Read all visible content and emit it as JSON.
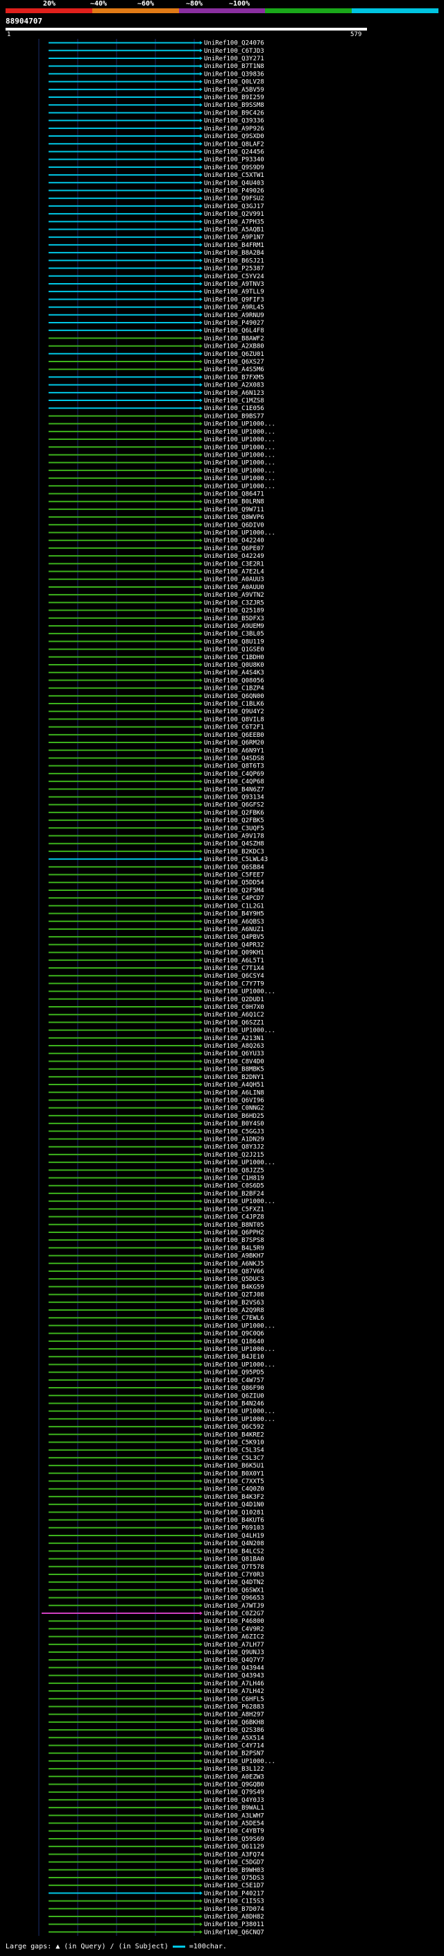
{
  "header": {
    "query_id": "88904707",
    "scale_start": "1",
    "scale_end": "579",
    "identity_legend": [
      {
        "label": "20%",
        "color": "#e0201c"
      },
      {
        "label": "~40%",
        "color": "#e07a16"
      },
      {
        "label": "~60%",
        "color": "#8a2fa0"
      },
      {
        "label": "~80%",
        "color": "#1aa81a"
      },
      {
        "label": "~100%",
        "color": "#00c4e0"
      }
    ]
  },
  "hits": [
    {
      "id": "UniRef100_Q24076",
      "color": "cyan"
    },
    {
      "id": "UniRef100_C6TJD3",
      "color": "cyan"
    },
    {
      "id": "UniRef100_Q3Y271",
      "color": "cyan"
    },
    {
      "id": "UniRef100_B7T1N8",
      "color": "cyan"
    },
    {
      "id": "UniRef100_Q39836",
      "color": "cyan"
    },
    {
      "id": "UniRef100_Q0LV28",
      "color": "cyan"
    },
    {
      "id": "UniRef100_A5BV59",
      "color": "cyan"
    },
    {
      "id": "UniRef100_B9I259",
      "color": "cyan"
    },
    {
      "id": "UniRef100_B9SSM8",
      "color": "cyan"
    },
    {
      "id": "UniRef100_B9C426",
      "color": "cyan"
    },
    {
      "id": "UniRef100_Q39336",
      "color": "cyan"
    },
    {
      "id": "UniRef100_A9P926",
      "color": "cyan"
    },
    {
      "id": "UniRef100_Q9SXD0",
      "color": "cyan"
    },
    {
      "id": "UniRef100_Q8LAF2",
      "color": "cyan"
    },
    {
      "id": "UniRef100_Q24456",
      "color": "cyan"
    },
    {
      "id": "UniRef100_P93340",
      "color": "cyan"
    },
    {
      "id": "UniRef100_Q9S9D9",
      "color": "cyan"
    },
    {
      "id": "UniRef100_C5XTW1",
      "color": "cyan"
    },
    {
      "id": "UniRef100_Q4U403",
      "color": "cyan"
    },
    {
      "id": "UniRef100_P49026",
      "color": "cyan"
    },
    {
      "id": "UniRef100_Q9FSU2",
      "color": "cyan"
    },
    {
      "id": "UniRef100_Q3GJ17",
      "color": "cyan"
    },
    {
      "id": "UniRef100_Q2V991",
      "color": "cyan"
    },
    {
      "id": "UniRef100_A7PH35",
      "color": "cyan"
    },
    {
      "id": "UniRef100_A5AQB1",
      "color": "cyan"
    },
    {
      "id": "UniRef100_A9P1N7",
      "color": "cyan"
    },
    {
      "id": "UniRef100_B4FRM1",
      "color": "cyan"
    },
    {
      "id": "UniRef100_B8A2B4",
      "color": "cyan"
    },
    {
      "id": "UniRef100_B6SJ21",
      "color": "cyan"
    },
    {
      "id": "UniRef100_P25387",
      "color": "cyan"
    },
    {
      "id": "UniRef100_C5YV24",
      "color": "cyan"
    },
    {
      "id": "UniRef100_A9TNV3",
      "color": "cyan"
    },
    {
      "id": "UniRef100_A9TLL9",
      "color": "cyan"
    },
    {
      "id": "UniRef100_Q9FIF3",
      "color": "cyan"
    },
    {
      "id": "UniRef100_A9RL45",
      "color": "cyan"
    },
    {
      "id": "UniRef100_A9RNU9",
      "color": "cyan"
    },
    {
      "id": "UniRef100_P49027",
      "color": "cyan"
    },
    {
      "id": "UniRef100_Q6L4F8",
      "color": "cyan"
    },
    {
      "id": "UniRef100_B8AWF2",
      "color": "green"
    },
    {
      "id": "UniRef100_A2XB80",
      "color": "green"
    },
    {
      "id": "UniRef100_Q6ZU01",
      "color": "cyan"
    },
    {
      "id": "UniRef100_Q6XS27",
      "color": "green"
    },
    {
      "id": "UniRef100_A4S5M6",
      "color": "green"
    },
    {
      "id": "UniRef100_B7FXM5",
      "color": "cyan"
    },
    {
      "id": "UniRef100_A2X083",
      "color": "cyan"
    },
    {
      "id": "UniRef100_A6N123",
      "color": "cyan"
    },
    {
      "id": "UniRef100_C1MZS8",
      "color": "cyan"
    },
    {
      "id": "UniRef100_C1E056",
      "color": "cyan"
    },
    {
      "id": "UniRef100_B9BS77",
      "color": "green"
    },
    {
      "id": "UniRef100_UP1000...",
      "color": "green"
    },
    {
      "id": "UniRef100_UP1000...",
      "color": "green"
    },
    {
      "id": "UniRef100_UP1000...",
      "color": "green"
    },
    {
      "id": "UniRef100_UP1000...",
      "color": "green"
    },
    {
      "id": "UniRef100_UP1000...",
      "color": "green"
    },
    {
      "id": "UniRef100_UP1000...",
      "color": "green"
    },
    {
      "id": "UniRef100_UP1000...",
      "color": "green"
    },
    {
      "id": "UniRef100_UP1000...",
      "color": "green"
    },
    {
      "id": "UniRef100_UP1000...",
      "color": "green"
    },
    {
      "id": "UniRef100_Q86471",
      "color": "green"
    },
    {
      "id": "UniRef100_B0LRN8",
      "color": "green"
    },
    {
      "id": "UniRef100_Q9W711",
      "color": "green"
    },
    {
      "id": "UniRef100_Q8WVP6",
      "color": "green"
    },
    {
      "id": "UniRef100_Q6DIV0",
      "color": "green"
    },
    {
      "id": "UniRef100_UP1000...",
      "color": "green"
    },
    {
      "id": "UniRef100_O42240",
      "color": "green"
    },
    {
      "id": "UniRef100_Q6PE07",
      "color": "green"
    },
    {
      "id": "UniRef100_O42249",
      "color": "green"
    },
    {
      "id": "UniRef100_C3E2R1",
      "color": "green"
    },
    {
      "id": "UniRef100_A7E2L4",
      "color": "green"
    },
    {
      "id": "UniRef100_A0AUU3",
      "color": "green"
    },
    {
      "id": "UniRef100_A0AUU0",
      "color": "green"
    },
    {
      "id": "UniRef100_A9VTN2",
      "color": "green"
    },
    {
      "id": "UniRef100_C3ZJR5",
      "color": "green"
    },
    {
      "id": "UniRef100_Q25189",
      "color": "green"
    },
    {
      "id": "UniRef100_B5DFX3",
      "color": "green"
    },
    {
      "id": "UniRef100_A9UEM9",
      "color": "green"
    },
    {
      "id": "UniRef100_C3BL05",
      "color": "green"
    },
    {
      "id": "UniRef100_Q8U119",
      "color": "green"
    },
    {
      "id": "UniRef100_Q1GSE0",
      "color": "green"
    },
    {
      "id": "UniRef100_C1BDH0",
      "color": "green"
    },
    {
      "id": "UniRef100_Q0U8K0",
      "color": "green"
    },
    {
      "id": "UniRef100_A4S4K3",
      "color": "green"
    },
    {
      "id": "UniRef100_Q08056",
      "color": "green"
    },
    {
      "id": "UniRef100_C1BZP4",
      "color": "green"
    },
    {
      "id": "UniRef100_Q6QN00",
      "color": "green"
    },
    {
      "id": "UniRef100_C1BLK6",
      "color": "green"
    },
    {
      "id": "UniRef100_Q9U4Y2",
      "color": "green"
    },
    {
      "id": "UniRef100_Q8VIL8",
      "color": "green"
    },
    {
      "id": "UniRef100_C6T2F1",
      "color": "green"
    },
    {
      "id": "UniRef100_Q6EEB0",
      "color": "green"
    },
    {
      "id": "UniRef100_Q6RM20",
      "color": "green"
    },
    {
      "id": "UniRef100_A6N9Y1",
      "color": "green"
    },
    {
      "id": "UniRef100_Q4SDS8",
      "color": "green"
    },
    {
      "id": "UniRef100_Q8T6T3",
      "color": "green"
    },
    {
      "id": "UniRef100_C4QP69",
      "color": "green"
    },
    {
      "id": "UniRef100_C4QP68",
      "color": "green"
    },
    {
      "id": "UniRef100_B4N6Z7",
      "color": "green"
    },
    {
      "id": "UniRef100_Q93134",
      "color": "green"
    },
    {
      "id": "UniRef100_Q6GFS2",
      "color": "green"
    },
    {
      "id": "UniRef100_Q2FBK6",
      "color": "green"
    },
    {
      "id": "UniRef100_Q2FBK5",
      "color": "green"
    },
    {
      "id": "UniRef100_C3UQF5",
      "color": "green"
    },
    {
      "id": "UniRef100_A9V178",
      "color": "green"
    },
    {
      "id": "UniRef100_Q4SZH8",
      "color": "green"
    },
    {
      "id": "UniRef100_B2KDC3",
      "color": "green"
    },
    {
      "id": "UniRef100_C5LWL43",
      "color": "cyan"
    },
    {
      "id": "UniRef100_Q6SB84",
      "color": "green"
    },
    {
      "id": "UniRef100_C5FEE7",
      "color": "green"
    },
    {
      "id": "UniRef100_Q5DD54",
      "color": "green"
    },
    {
      "id": "UniRef100_Q2F5M4",
      "color": "green"
    },
    {
      "id": "UniRef100_C4PCD7",
      "color": "green"
    },
    {
      "id": "UniRef100_C1L2G1",
      "color": "green"
    },
    {
      "id": "UniRef100_B4Y9H5",
      "color": "green"
    },
    {
      "id": "UniRef100_A6QBS3",
      "color": "green"
    },
    {
      "id": "UniRef100_A6NUZ1",
      "color": "green"
    },
    {
      "id": "UniRef100_Q4PBV5",
      "color": "green"
    },
    {
      "id": "UniRef100_Q4PR32",
      "color": "green"
    },
    {
      "id": "UniRef100_Q09KH1",
      "color": "green"
    },
    {
      "id": "UniRef100_A6L5T1",
      "color": "green"
    },
    {
      "id": "UniRef100_C7T1X4",
      "color": "green"
    },
    {
      "id": "UniRef100_Q6CSY4",
      "color": "green"
    },
    {
      "id": "UniRef100_C7Y7T9",
      "color": "green"
    },
    {
      "id": "UniRef100_UP1000...",
      "color": "green"
    },
    {
      "id": "UniRef100_Q2DUD1",
      "color": "green"
    },
    {
      "id": "UniRef100_C0H7X0",
      "color": "green"
    },
    {
      "id": "UniRef100_A6Q1C2",
      "color": "green"
    },
    {
      "id": "UniRef100_Q6SZZ1",
      "color": "green"
    },
    {
      "id": "UniRef100_UP1000...",
      "color": "green"
    },
    {
      "id": "UniRef100_A213N1",
      "color": "green"
    },
    {
      "id": "UniRef100_A8Q263",
      "color": "green"
    },
    {
      "id": "UniRef100_Q6YU33",
      "color": "green"
    },
    {
      "id": "UniRef100_C8V4D0",
      "color": "green"
    },
    {
      "id": "UniRef100_B8MBK5",
      "color": "green"
    },
    {
      "id": "UniRef100_B2DNY1",
      "color": "green"
    },
    {
      "id": "UniRef100_A4QH51",
      "color": "green"
    },
    {
      "id": "UniRef100_A6LIN8",
      "color": "green"
    },
    {
      "id": "UniRef100_Q6VI96",
      "color": "green"
    },
    {
      "id": "UniRef100_C0NNG2",
      "color": "green"
    },
    {
      "id": "UniRef100_B6HD25",
      "color": "green"
    },
    {
      "id": "UniRef100_B0Y4S0",
      "color": "green"
    },
    {
      "id": "UniRef100_C5GGJ3",
      "color": "green"
    },
    {
      "id": "UniRef100_A1DN29",
      "color": "green"
    },
    {
      "id": "UniRef100_Q8Y3J2",
      "color": "green"
    },
    {
      "id": "UniRef100_Q2J215",
      "color": "green"
    },
    {
      "id": "UniRef100_UP1000...",
      "color": "green"
    },
    {
      "id": "UniRef100_Q8JZZ5",
      "color": "green"
    },
    {
      "id": "UniRef100_C1H819",
      "color": "green"
    },
    {
      "id": "UniRef100_C0S6D5",
      "color": "green"
    },
    {
      "id": "UniRef100_B2BF24",
      "color": "green"
    },
    {
      "id": "UniRef100_UP1000...",
      "color": "green"
    },
    {
      "id": "UniRef100_C5FXZ1",
      "color": "green"
    },
    {
      "id": "UniRef100_C4JPZ8",
      "color": "green"
    },
    {
      "id": "UniRef100_B8NT05",
      "color": "green"
    },
    {
      "id": "UniRef100_Q6PPH2",
      "color": "green"
    },
    {
      "id": "UniRef100_B7SPS8",
      "color": "green"
    },
    {
      "id": "UniRef100_B4L5R9",
      "color": "green"
    },
    {
      "id": "UniRef100_A9BKH7",
      "color": "green"
    },
    {
      "id": "UniRef100_A6NKJ5",
      "color": "green"
    },
    {
      "id": "UniRef100_Q87V66",
      "color": "green"
    },
    {
      "id": "UniRef100_Q5DUC3",
      "color": "green"
    },
    {
      "id": "UniRef100_B4KG59",
      "color": "green"
    },
    {
      "id": "UniRef100_Q2TJ08",
      "color": "green"
    },
    {
      "id": "UniRef100_B2VS63",
      "color": "green"
    },
    {
      "id": "UniRef100_A2Q9R8",
      "color": "green"
    },
    {
      "id": "UniRef100_C7EWL6",
      "color": "green"
    },
    {
      "id": "UniRef100_UP1000...",
      "color": "green"
    },
    {
      "id": "UniRef100_Q9C0Q6",
      "color": "green"
    },
    {
      "id": "UniRef100_Q18640",
      "color": "green"
    },
    {
      "id": "UniRef100_UP1000...",
      "color": "green"
    },
    {
      "id": "UniRef100_B4JE10",
      "color": "green"
    },
    {
      "id": "UniRef100_UP1000...",
      "color": "green"
    },
    {
      "id": "UniRef100_Q95PD5",
      "color": "green"
    },
    {
      "id": "UniRef100_C4W757",
      "color": "green"
    },
    {
      "id": "UniRef100_Q86F90",
      "color": "green"
    },
    {
      "id": "UniRef100_Q6ZIU0",
      "color": "green"
    },
    {
      "id": "UniRef100_B4N246",
      "color": "green"
    },
    {
      "id": "UniRef100_UP1000...",
      "color": "green"
    },
    {
      "id": "UniRef100_UP1000...",
      "color": "green"
    },
    {
      "id": "UniRef100_Q6C592",
      "color": "green"
    },
    {
      "id": "UniRef100_B4KRE2",
      "color": "green"
    },
    {
      "id": "UniRef100_C5K910",
      "color": "green"
    },
    {
      "id": "UniRef100_C5L3S4",
      "color": "green"
    },
    {
      "id": "UniRef100_C5L3C7",
      "color": "green"
    },
    {
      "id": "UniRef100_B6K5U1",
      "color": "green"
    },
    {
      "id": "UniRef100_B0X0Y1",
      "color": "green"
    },
    {
      "id": "UniRef100_C7XXT5",
      "color": "green"
    },
    {
      "id": "UniRef100_C4Q0Z0",
      "color": "green"
    },
    {
      "id": "UniRef100_B4K3F2",
      "color": "green"
    },
    {
      "id": "UniRef100_Q4D1N0",
      "color": "green"
    },
    {
      "id": "UniRef100_Q10281",
      "color": "green"
    },
    {
      "id": "UniRef100_B4KUT6",
      "color": "green"
    },
    {
      "id": "UniRef100_P69103",
      "color": "green"
    },
    {
      "id": "UniRef100_Q4LH19",
      "color": "green"
    },
    {
      "id": "UniRef100_Q4N208",
      "color": "green"
    },
    {
      "id": "UniRef100_B4LCS2",
      "color": "green"
    },
    {
      "id": "UniRef100_Q81BA0",
      "color": "green"
    },
    {
      "id": "UniRef100_Q7T578",
      "color": "green"
    },
    {
      "id": "UniRef100_C7Y0R3",
      "color": "green"
    },
    {
      "id": "UniRef100_Q4DTN2",
      "color": "green"
    },
    {
      "id": "UniRef100_Q6SWX1",
      "color": "green"
    },
    {
      "id": "UniRef100_Q96653",
      "color": "green"
    },
    {
      "id": "UniRef100_A7WTJ9",
      "color": "green"
    },
    {
      "id": "UniRef100_C0Z2G7",
      "color": "magenta"
    },
    {
      "id": "UniRef100_P46800",
      "color": "green"
    },
    {
      "id": "UniRef100_C4V9R2",
      "color": "green"
    },
    {
      "id": "UniRef100_A6ZIC2",
      "color": "green"
    },
    {
      "id": "UniRef100_A7LH77",
      "color": "green"
    },
    {
      "id": "UniRef100_Q9UNJ3",
      "color": "green"
    },
    {
      "id": "UniRef100_Q4Q7Y7",
      "color": "green"
    },
    {
      "id": "UniRef100_Q43944",
      "color": "green"
    },
    {
      "id": "UniRef100_Q43943",
      "color": "green"
    },
    {
      "id": "UniRef100_A7LH46",
      "color": "green"
    },
    {
      "id": "UniRef100_A7LH42",
      "color": "green"
    },
    {
      "id": "UniRef100_C6HFL5",
      "color": "green"
    },
    {
      "id": "UniRef100_P62883",
      "color": "green"
    },
    {
      "id": "UniRef100_A8H297",
      "color": "green"
    },
    {
      "id": "UniRef100_Q6BKH8",
      "color": "green"
    },
    {
      "id": "UniRef100_Q2S386",
      "color": "green"
    },
    {
      "id": "UniRef100_A5X514",
      "color": "green"
    },
    {
      "id": "UniRef100_C4Y714",
      "color": "green"
    },
    {
      "id": "UniRef100_B2PSN7",
      "color": "green"
    },
    {
      "id": "UniRef100_UP1000...",
      "color": "green"
    },
    {
      "id": "UniRef100_B3L122",
      "color": "green"
    },
    {
      "id": "UniRef100_A0EZW3",
      "color": "green"
    },
    {
      "id": "UniRef100_Q9GQB0",
      "color": "green"
    },
    {
      "id": "UniRef100_Q79S49",
      "color": "green"
    },
    {
      "id": "UniRef100_Q4Y0J3",
      "color": "green"
    },
    {
      "id": "UniRef100_B9WAL1",
      "color": "green"
    },
    {
      "id": "UniRef100_A3LWH7",
      "color": "green"
    },
    {
      "id": "UniRef100_A5DE54",
      "color": "green"
    },
    {
      "id": "UniRef100_C4YBT9",
      "color": "green"
    },
    {
      "id": "UniRef100_Q59S69",
      "color": "green"
    },
    {
      "id": "UniRef100_Q61129",
      "color": "green"
    },
    {
      "id": "UniRef100_A3FQ74",
      "color": "green"
    },
    {
      "id": "UniRef100_C5DGD7",
      "color": "green"
    },
    {
      "id": "UniRef100_B9WH03",
      "color": "green"
    },
    {
      "id": "UniRef100_Q75DS3",
      "color": "green"
    },
    {
      "id": "UniRef100_C5E1D7",
      "color": "green"
    },
    {
      "id": "UniRef100_P40217",
      "color": "cyan"
    },
    {
      "id": "UniRef100_C1I5S3",
      "color": "green"
    },
    {
      "id": "UniRef100_B7D074",
      "color": "green"
    },
    {
      "id": "UniRef100_A8DH82",
      "color": "green"
    },
    {
      "id": "UniRef100_P38011",
      "color": "green"
    },
    {
      "id": "UniRef100_Q6CNQ7",
      "color": "green"
    }
  ],
  "colors": {
    "cyan": "#00c8e6",
    "green": "#3cb21c",
    "magenta": "#d040c0",
    "track": "#0a0a1e",
    "gridline": "#1a2b6a"
  },
  "footer": {
    "large_gaps_label": "Large gaps:",
    "in_query": "(in Query)",
    "in_subject": "(in Subject)",
    "scale_label": "=100char."
  }
}
